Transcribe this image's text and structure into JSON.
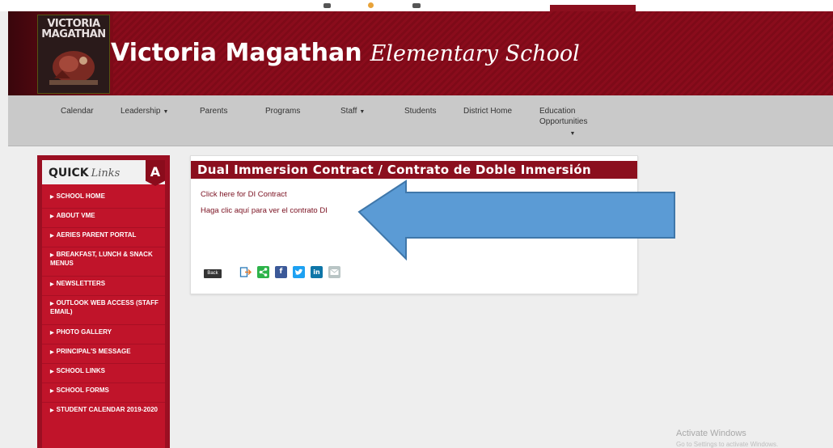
{
  "colors": {
    "brand": "#8b0f1e",
    "sidebar": "#c0142a",
    "nav": "#c9c9c9",
    "arrow": "#5b9bd5"
  },
  "header": {
    "logo_text": "VICTORIA MAGATHAN",
    "title_bold": "Victoria Magathan",
    "title_script": "Elementary School"
  },
  "nav": {
    "items": [
      {
        "label": "Calendar"
      },
      {
        "label": "Leadership",
        "caret": "▼"
      },
      {
        "label": "Parents"
      },
      {
        "label": "Programs"
      },
      {
        "label": "Staff",
        "caret": "▼"
      },
      {
        "label": "Students"
      },
      {
        "label": "District Home"
      },
      {
        "label": "Education Opportunities",
        "caret": "▼"
      }
    ]
  },
  "sidebar": {
    "title": "QUICK",
    "title_script": "Links",
    "badge": "A",
    "items": [
      "SCHOOL HOME",
      "ABOUT VME",
      "AERIES PARENT PORTAL",
      "BREAKFAST, LUNCH & SNACK MENUS",
      "NEWSLETTERS",
      "OUTLOOK WEB ACCESS (STAFF EMAIL)",
      "PHOTO GALLERY",
      "PRINCIPAL'S MESSAGE",
      "SCHOOL LINKS",
      "SCHOOL FORMS",
      "STUDENT CALENDAR 2019-2020"
    ]
  },
  "panel": {
    "title": "Dual Immersion Contract / Contrato de Doble Inmersión",
    "link_en": "Click here for DI Contract",
    "link_es": "Haga clic aquí para ver el contrato DI",
    "back_label": "Back",
    "share_icons": [
      "export-icon",
      "share-icon",
      "facebook-icon",
      "twitter-icon",
      "linkedin-icon",
      "email-icon"
    ]
  },
  "watermark": {
    "line1": "Activate Windows",
    "line2": "Go to Settings to activate Windows."
  }
}
